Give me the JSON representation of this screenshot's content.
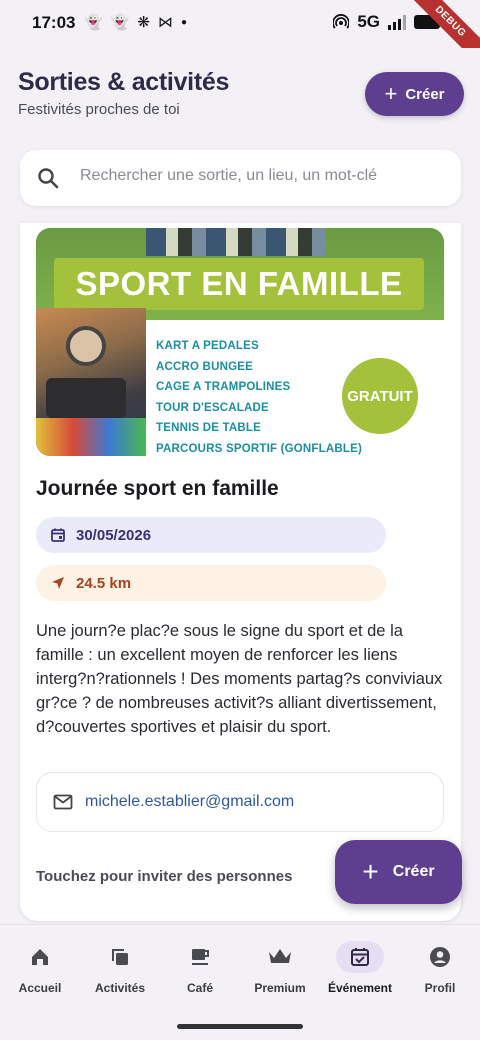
{
  "status_bar": {
    "time": "17:03",
    "network": "5G",
    "debug_label": "DEBUG"
  },
  "header": {
    "title": "Sorties & activités",
    "subtitle": "Festivités proches de toi",
    "create_label": "Créer"
  },
  "search": {
    "placeholder": "Rechercher une sortie, un lieu, un mot-clé"
  },
  "event": {
    "poster": {
      "banner": "SPORT EN FAMILLE",
      "activities": [
        "KART A PEDALES",
        "ACCRO BUNGEE",
        "CAGE A TRAMPOLINES",
        "TOUR D'ESCALADE",
        "TENNIS DE TABLE",
        "PARCOURS SPORTIF (GONFLABLE)"
      ],
      "badge": "GRATUIT"
    },
    "title": "Journée sport en famille",
    "date": "30/05/2026",
    "distance": "24.5 km",
    "description": "Une journ?e plac?e sous le signe du sport et de la famille : un excellent moyen de renforcer les liens interg?n?rationnels ! Des moments partag?s conviviaux gr?ce ? de nombreuses activit?s alliant divertissement, d?couvertes sportives et plaisir du sport.",
    "email": "michele.establier@gmail.com",
    "invite_text": "Touchez pour inviter des personnes"
  },
  "fab": {
    "label": "Créer"
  },
  "nav": {
    "items": [
      {
        "label": "Accueil",
        "icon": "home-icon"
      },
      {
        "label": "Activités",
        "icon": "copy-icon"
      },
      {
        "label": "Café",
        "icon": "coffee-icon"
      },
      {
        "label": "Premium",
        "icon": "crown-icon"
      },
      {
        "label": "Événement",
        "icon": "event-icon",
        "active": true
      },
      {
        "label": "Profil",
        "icon": "account-icon"
      }
    ]
  },
  "colors": {
    "primary": "#5e3e8f",
    "date_bg": "#e9ebfb",
    "distance_bg": "#fdf2e4",
    "link": "#2f57a0"
  }
}
